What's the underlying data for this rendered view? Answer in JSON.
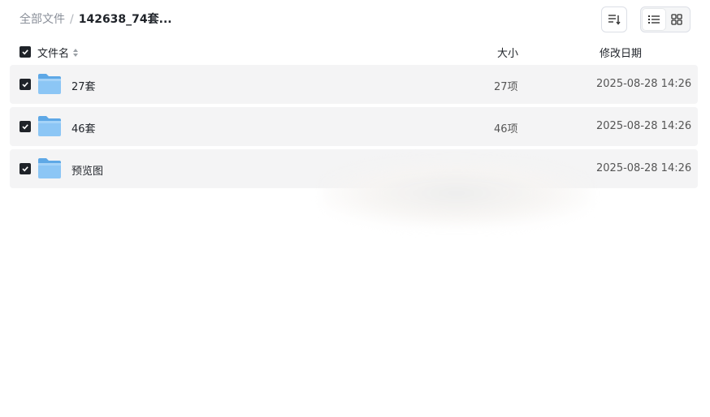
{
  "breadcrumb": {
    "root": "全部文件",
    "separator": "/",
    "current": "142638_74套..."
  },
  "toolbar": {
    "sort_icon": "sort-icon",
    "list_view_icon": "list-view-icon",
    "grid_view_icon": "grid-view-icon",
    "active_view": "list"
  },
  "columns": {
    "name": "文件名",
    "size": "大小",
    "date": "修改日期"
  },
  "files": [
    {
      "name": "27套",
      "size": "27项",
      "date": "2025-08-28 14:26",
      "checked": true
    },
    {
      "name": "46套",
      "size": "46项",
      "date": "2025-08-28 14:26",
      "checked": true
    },
    {
      "name": "预览图",
      "size": "",
      "date": "2025-08-28 14:26",
      "checked": true
    }
  ],
  "colors": {
    "folder": "#7cbcf0",
    "row_bg": "#f4f4f5",
    "checkbox": "#1f2329"
  }
}
